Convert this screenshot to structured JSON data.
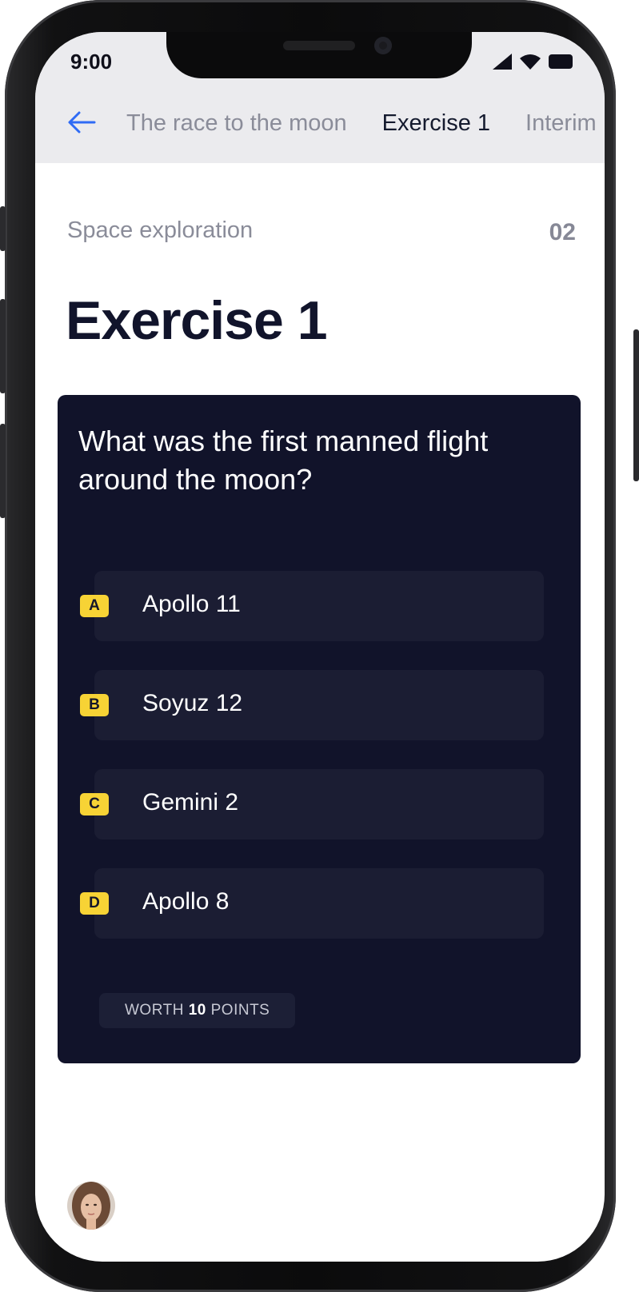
{
  "status_bar": {
    "time": "9:00"
  },
  "nav": {
    "back_icon": "arrow-left-icon",
    "breadcrumbs": [
      {
        "label": "The race to the moon",
        "active": false
      },
      {
        "label": "Exercise 1",
        "active": true
      },
      {
        "label": "Interim",
        "active": false
      }
    ]
  },
  "header": {
    "course": "Space exploration",
    "number": "02"
  },
  "exercise": {
    "title": "Exercise 1",
    "question": "What was the first manned flight around the moon?",
    "options": [
      {
        "letter": "A",
        "label": "Apollo 11"
      },
      {
        "letter": "B",
        "label": "Soyuz 12"
      },
      {
        "letter": "C",
        "label": "Gemini 2"
      },
      {
        "letter": "D",
        "label": "Apollo 8"
      }
    ],
    "points": {
      "prefix": "WORTH",
      "value": "10",
      "suffix": "POINTS"
    }
  },
  "colors": {
    "card": "#11132a",
    "option": "#1b1d33",
    "badge": "#f7d335",
    "accent": "#2f6bf5",
    "title": "#11142b"
  },
  "avatar": {
    "icon": "user-avatar"
  }
}
